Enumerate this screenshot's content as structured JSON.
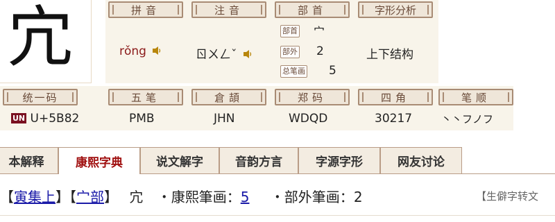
{
  "character": "宂",
  "labels": {
    "pinyin": "拼音",
    "zhuyin": "注音",
    "bushou": "部首",
    "structure": "字形分析",
    "unicode": "统一码",
    "wubi": "五笔",
    "cangjie": "倉頡",
    "zhengma": "郑码",
    "sijiao": "四角",
    "bishun": "笔顺"
  },
  "values": {
    "pinyin": "rǒng",
    "zhuyin": "ㄖㄨㄥˇ",
    "radical_tag": "部首",
    "radical": "宀",
    "outer_tag": "部外",
    "outer_strokes": "2",
    "total_tag": "总笔画",
    "total_strokes": "5",
    "structure": "上下结构",
    "unicode": "U+5B82",
    "wubi": "PMB",
    "cangjie": "JHN",
    "zhengma": "WDQD",
    "sijiao": "30217",
    "bishun": "丶丶フノフ",
    "unicode_badge": "UN"
  },
  "tabs": [
    "本解释",
    "康熙字典",
    "说文解字",
    "音韵方言",
    "字源字形",
    "网友讨论"
  ],
  "active_tab": 1,
  "entry": {
    "open1": "【",
    "collection": "寅集上",
    "close1": "】【",
    "radical": "宀部",
    "close2": "】",
    "char": "宂",
    "kangxi_label": "・康熙筆画：",
    "kangxi_strokes": "5",
    "outer_label": "・部外筆画：",
    "outer_strokes": "2",
    "hint": "【生僻字转文"
  },
  "colors": {
    "accent": "#a01010",
    "label_border": "#a88b74",
    "panel": "#f8f4ea",
    "link": "#1a1aa8"
  },
  "icons": [
    "speaker-icon",
    "unicode-logo-icon"
  ]
}
